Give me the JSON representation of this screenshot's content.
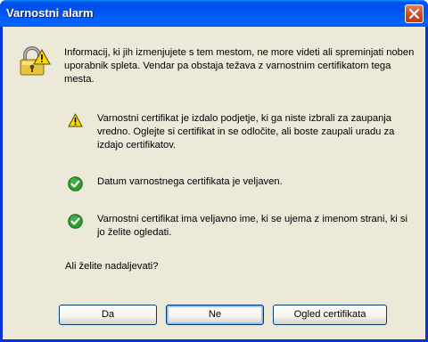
{
  "window": {
    "title": "Varnostni alarm",
    "close_icon": "close-icon"
  },
  "intro": {
    "icon": "security-lock-icon",
    "text": "Informacij, ki jih izmenjujete s tem mestom, ne more videti ali spreminjati noben uporabnik spleta. Vendar pa obstaja težava z varnostnim certifikatom tega mesta."
  },
  "checks": [
    {
      "icon": "warning-icon",
      "status": "warning",
      "text": "Varnostni certifikat je izdalo podjetje, ki ga niste izbrali za zaupanja vredno. Oglejte si certifikat in se odločite, ali boste zaupali uradu za izdajo certifikatov."
    },
    {
      "icon": "checkmark-icon",
      "status": "ok",
      "text": "Datum varnostnega certifikata je veljaven."
    },
    {
      "icon": "checkmark-icon",
      "status": "ok",
      "text": "Varnostni certifikat ima veljavno ime, ki se ujema z imenom strani, ki si jo želite ogledati."
    }
  ],
  "question": "Ali želite nadaljevati?",
  "buttons": {
    "yes": "Da",
    "no": "Ne",
    "view_certificate": "Ogled certifikata"
  },
  "colors": {
    "titlebar": "#0054e3",
    "client_background": "#ece9d8",
    "close_button": "#d54a21",
    "ok_green": "#2f9d2f",
    "warning_yellow": "#f8d800"
  }
}
